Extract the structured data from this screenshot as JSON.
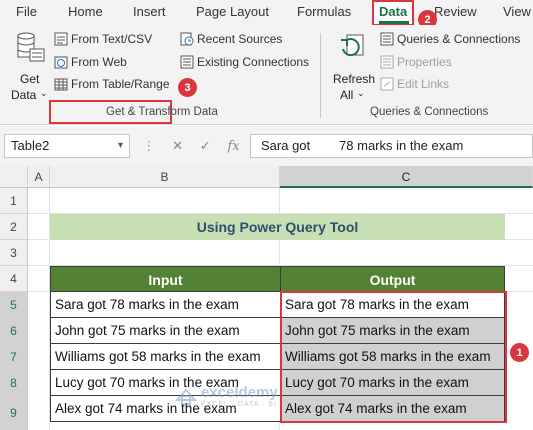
{
  "ribbon_tabs": [
    "File",
    "Home",
    "Insert",
    "Page Layout",
    "Formulas",
    "Data",
    "Review",
    "View"
  ],
  "ribbon": {
    "get_data_line1": "Get",
    "get_data_line2": "Data",
    "from_text_csv": "From Text/CSV",
    "from_web": "From Web",
    "from_table_range": "From Table/Range",
    "recent_sources": "Recent Sources",
    "existing_connections": "Existing Connections",
    "group_get_transform": "Get & Transform Data",
    "refresh_all_line1": "Refresh",
    "refresh_all_line2": "All",
    "queries_connections": "Queries & Connections",
    "properties": "Properties",
    "edit_links": "Edit Links",
    "group_queries": "Queries & Connections"
  },
  "badges": {
    "b1": "1",
    "b2": "2",
    "b3": "3"
  },
  "formula_bar": {
    "name_box": "Table2",
    "fx": "fx",
    "content": "Sara got        78 marks in the exam"
  },
  "columns": [
    "A",
    "B",
    "C"
  ],
  "rows": [
    "1",
    "2",
    "3",
    "4",
    "5",
    "6",
    "7",
    "8",
    "9"
  ],
  "sheet": {
    "title": "Using Power Query Tool",
    "header_input": "Input",
    "header_output": "Output",
    "input_rows": [
      "Sara got 78 marks in the exam",
      "John got 75 marks in the exam",
      "Williams got 58 marks in the exam",
      "Lucy got 70 marks in the exam",
      "Alex got 74 marks in the exam"
    ],
    "output_rows": [
      "Sara got 78 marks in the exam",
      "John got 75 marks in the exam",
      "Williams got 58 marks in the exam",
      "Lucy got 70 marks in the exam",
      "Alex got 74 marks in the exam"
    ]
  },
  "watermark": {
    "name": "exceldemy",
    "tagline": "EXCEL · DATA · BI"
  },
  "colors": {
    "accent": "#d9373d",
    "excel_green": "#217346",
    "header_green": "#548235",
    "title_fill": "#c6e0b4"
  }
}
